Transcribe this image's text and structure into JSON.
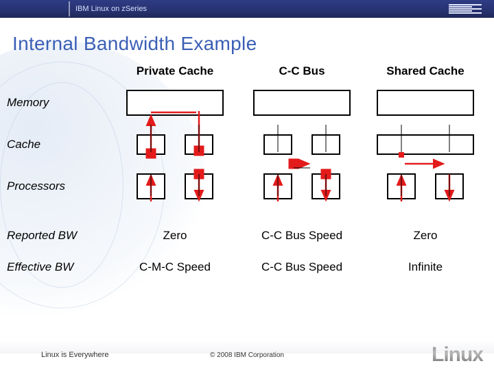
{
  "header": {
    "breadcrumb": "IBM Linux on zSeries",
    "logo_name": "ibm-logo"
  },
  "title": "Internal Bandwidth Example",
  "columns": [
    {
      "label": "Private Cache"
    },
    {
      "label": "C-C Bus"
    },
    {
      "label": "Shared Cache"
    }
  ],
  "rows": {
    "memory": "Memory",
    "cache": "Cache",
    "processors": "Processors",
    "reported_bw": "Reported BW",
    "effective_bw": "Effective BW"
  },
  "values": {
    "reported": [
      "Zero",
      "C-C Bus Speed",
      "Zero"
    ],
    "effective": [
      "C-M-C Speed",
      "C-C Bus Speed",
      "Infinite"
    ]
  },
  "footer": {
    "left": "Linux is Everywhere",
    "center": "© 2008 IBM Corporation",
    "right_logo_text": "Linux"
  },
  "chart_data": {
    "type": "table",
    "title": "Internal Bandwidth Example",
    "columns": [
      "",
      "Private Cache",
      "C-C Bus",
      "Shared Cache"
    ],
    "rows": [
      [
        "Memory",
        "shared memory block",
        "shared memory block",
        "shared memory block"
      ],
      [
        "Cache",
        "two private caches",
        "two caches connected by C-C bus",
        "one shared cache"
      ],
      [
        "Processors",
        "two processors",
        "two processors",
        "two processors"
      ],
      [
        "Reported BW",
        "Zero",
        "C-C Bus Speed",
        "Zero"
      ],
      [
        "Effective BW",
        "C-M-C Speed",
        "C-C Bus Speed",
        "Infinite"
      ]
    ],
    "diagram_semantics": {
      "Private Cache": "Each processor has its own cache; inter-cache transfer goes through memory (C-M-C path).",
      "C-C Bus": "Caches linked by a cache-to-cache bus; transfer at bus speed.",
      "Shared Cache": "Both processors share one cache; inter-processor bandwidth effectively infinite."
    }
  }
}
